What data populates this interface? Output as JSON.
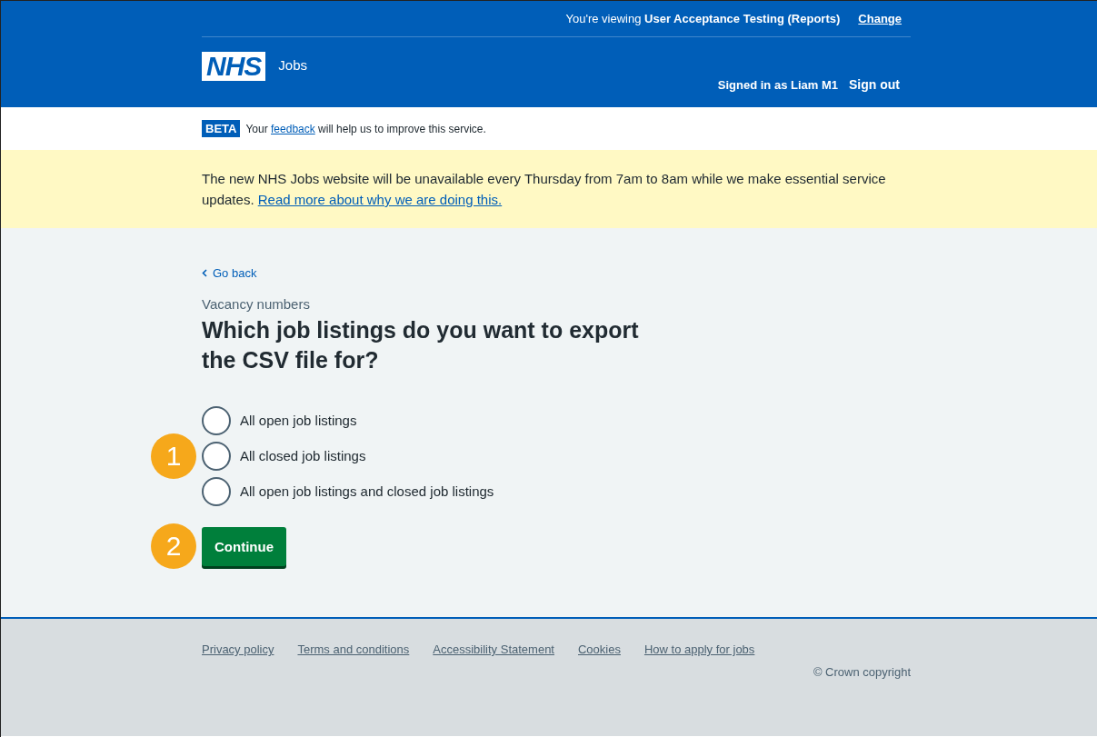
{
  "header": {
    "viewing": "You're viewing **User Acceptance Testing (Reports)**",
    "change_link": "Change",
    "logo": "NHS",
    "service": "Jobs",
    "signed_in": "Signed in as Liam M1",
    "sign_out": "Sign out"
  },
  "phase_banner": {
    "tag": "BETA",
    "text_before": "Your",
    "link": "feedback",
    "text_after": "will help us to improve this service."
  },
  "notice": {
    "text": "The new NHS Jobs website will be unavailable every Thursday from 7am to 8am while we make essential service updates.",
    "link": "Read more about why we are doing this."
  },
  "back_link": "Go back",
  "caption": "Vacancy numbers",
  "heading": "Which job listings do you want to export the CSV file for?",
  "radios": [
    {
      "label": "All open job listings",
      "selected": false
    },
    {
      "label": "All closed job listings",
      "selected": false,
      "callout": "1"
    },
    {
      "label": "All open job listings and closed job listings",
      "selected": false
    }
  ],
  "continue_button": {
    "label": "Continue",
    "callout": "2"
  },
  "footer": {
    "links": [
      "Privacy policy",
      "Terms and conditions",
      "Accessibility Statement",
      "Cookies",
      "How to apply for jobs"
    ],
    "copyright": "© Crown copyright"
  }
}
